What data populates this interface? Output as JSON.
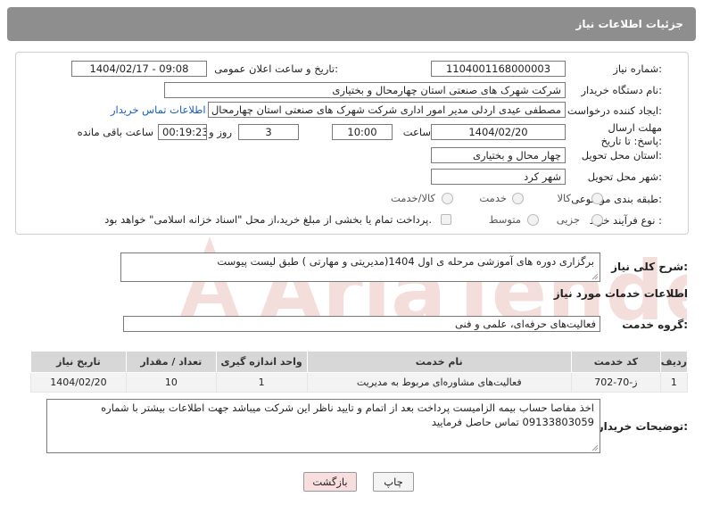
{
  "header": {
    "title": "جزئیات اطلاعات نیاز"
  },
  "form": {
    "need_number_label": "شماره نیاز:",
    "need_number": "1104001168000003",
    "announce_label": "تاریخ و ساعت اعلان عمومی:",
    "announce_value": "1404/02/17 - 09:08",
    "buyer_org_label": "نام دستگاه خریدار:",
    "buyer_org": "شرکت شهرک های صنعتی استان چهارمحال و بختیاری",
    "requester_label": "ایجاد کننده درخواست:",
    "requester": "مصطفی عیدی اردلی مدیر امور اداری شرکت شهرک های صنعتی استان چهارمحال",
    "buyer_contact_link": "اطلاعات تماس خریدار",
    "deadline_label": "مهلت ارسال پاسخ: تا تاریخ:",
    "deadline_date": "1404/02/20",
    "time_label": "ساعت",
    "deadline_time": "10:00",
    "days_value": "3",
    "days_label": "روز و",
    "remaining_time": "00:19:23",
    "remaining_label": "ساعت باقی مانده",
    "province_label": "استان محل تحویل:",
    "province": "چهار محال و بختیاری",
    "city_label": "شهر محل تحویل:",
    "city": "شهر کرد",
    "category_label": "طبقه بندی موضوعی:",
    "category_options": [
      "کالا",
      "خدمت",
      "کالا/خدمت"
    ],
    "process_label": "نوع فرآیند خرید :",
    "process_options": [
      "جزیی",
      "متوسط"
    ],
    "payment_note": "پرداخت تمام یا بخشی از مبلغ خرید،از محل \"اسناد خزانه اسلامی\" خواهد بود."
  },
  "summary": {
    "label": "شرح کلی نیاز:",
    "text": "برگزاری دوره های آموزشی مرحله ی اول 1404(مدیریتی و مهارتی ) طبق لیست پیوست"
  },
  "services": {
    "section_title": "اطلاعات خدمات مورد نیاز",
    "group_label": "گروه خدمت:",
    "group_value": "فعالیت‌های حرفه‌ای، علمی و فنی",
    "columns": [
      "ردیف",
      "کد خدمت",
      "نام خدمت",
      "واحد اندازه گیری",
      "تعداد / مقدار",
      "تاریخ نیاز"
    ],
    "rows": [
      [
        "1",
        "ز-70-702",
        "فعالیت‌های مشاوره‌ای مربوط به مدیریت",
        "1",
        "10",
        "1404/02/20"
      ]
    ]
  },
  "notes": {
    "label": "توضیحات خریدار:",
    "text": "اخذ مفاصا حساب بیمه الزامیست پرداخت بعد از اتمام و تایید ناظر این شرکت میباشد جهت اطلاعات بیشتر با شماره 09133803059 تماس حاصل فرمایید"
  },
  "buttons": {
    "print": "چاپ",
    "back": "بازگشت"
  },
  "watermark": {
    "text": "AriaTender.neT"
  },
  "colors": {
    "header_bg": "#8e8e8e",
    "link": "#1a5fb4",
    "back_button_bg": "#f8dede",
    "watermark": "#c0392b"
  }
}
